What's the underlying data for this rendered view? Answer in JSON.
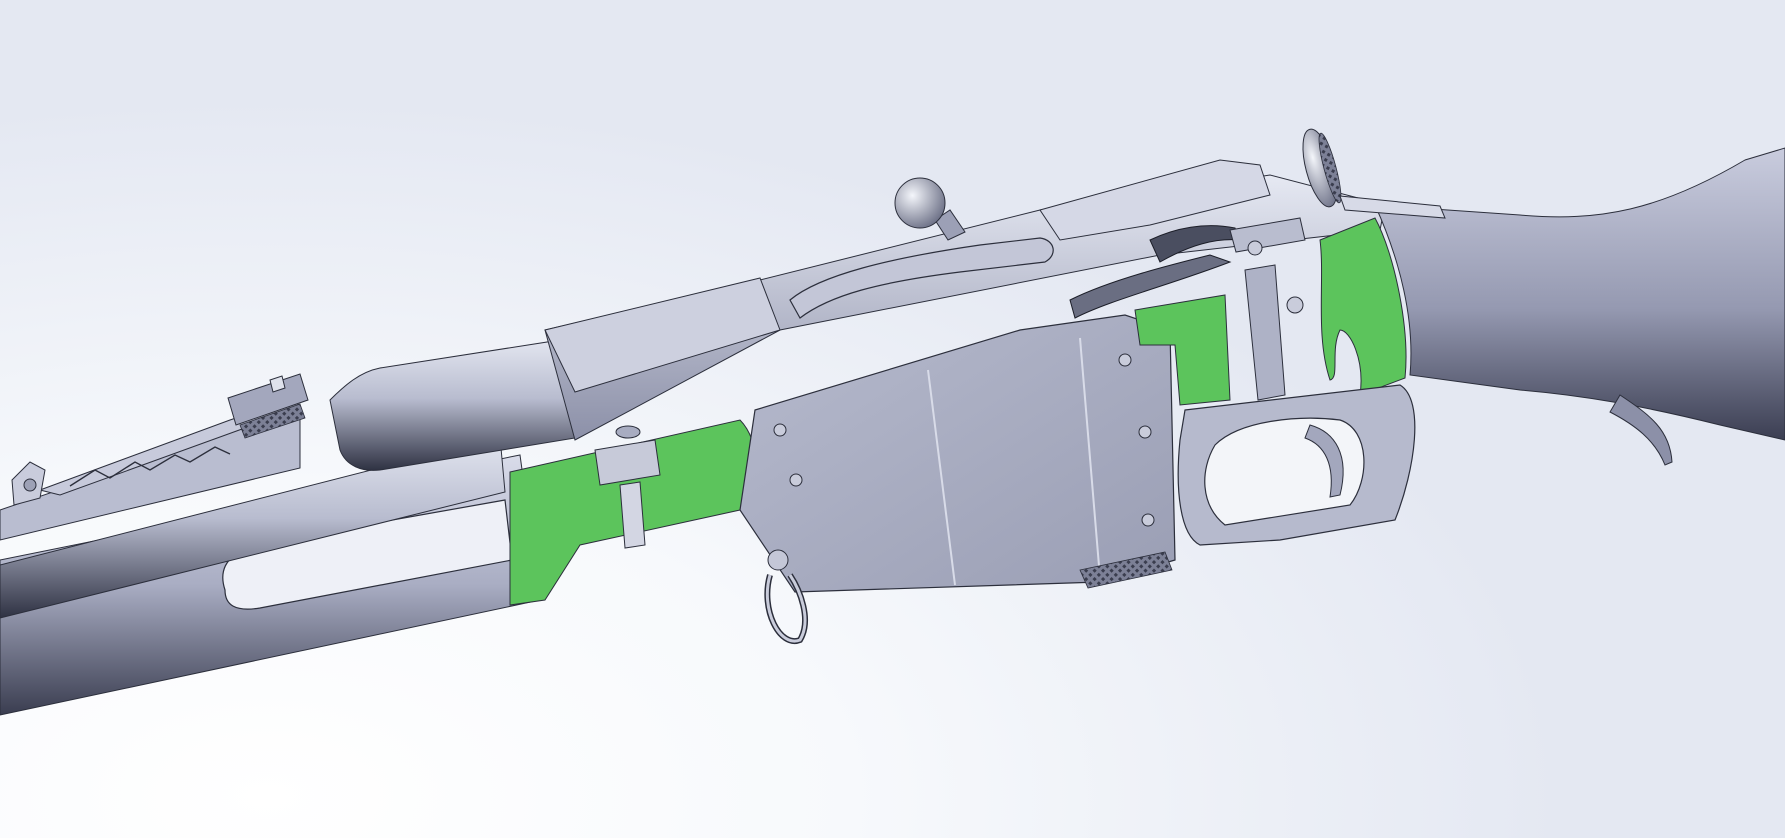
{
  "viewport": {
    "background_color": "#eef1f7",
    "model": "rifle-action-assembly",
    "view": "isometric-shaded-with-edges"
  },
  "colors": {
    "steel": "#b4b8cd",
    "steel_light": "#d8dbe8",
    "steel_dark": "#34384a",
    "section_cut": "#5cc45c",
    "edge": "#2c2f3c"
  },
  "markings": {
    "barrel_stamp_lines": [
      "",
      "",
      "",
      ""
    ],
    "receiver_stamp": ""
  }
}
